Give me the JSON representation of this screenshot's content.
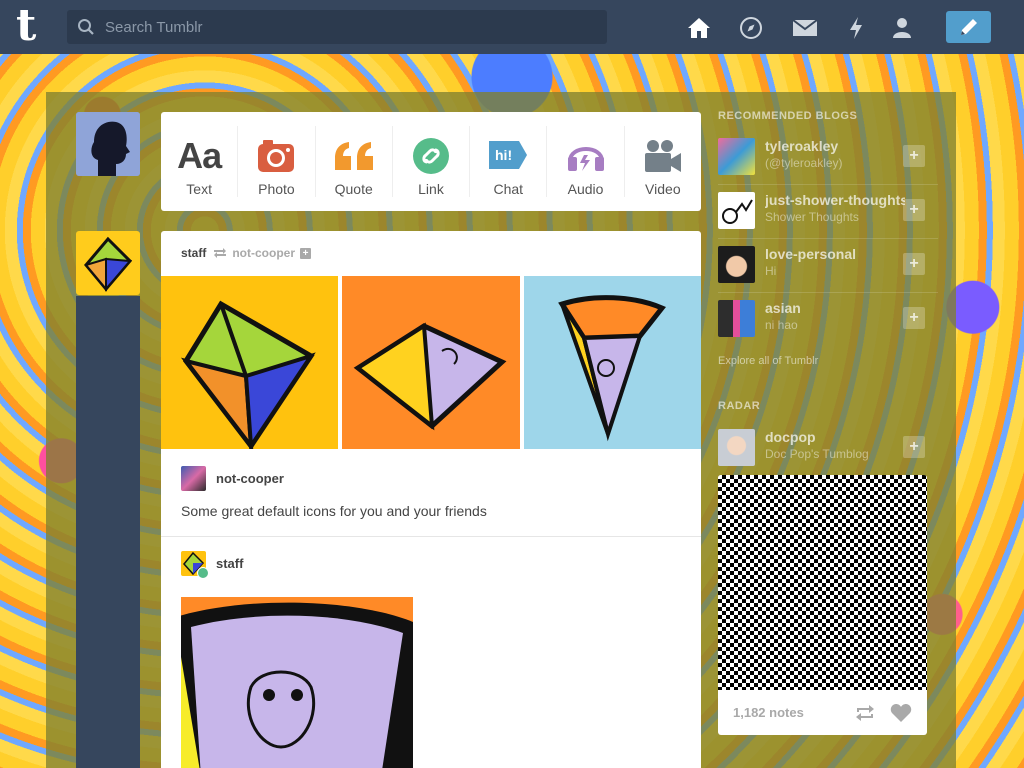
{
  "header": {
    "logo": "t",
    "search_placeholder": "Search Tumblr",
    "nav": [
      "home-icon",
      "explore-compass-icon",
      "inbox-icon",
      "activity-lightning-icon",
      "account-person-icon"
    ],
    "compose": "pencil-icon"
  },
  "composer": {
    "types": [
      {
        "label": "Text",
        "icon": "text-icon",
        "color": "#444444"
      },
      {
        "label": "Photo",
        "icon": "camera-icon",
        "color": "#d95e40"
      },
      {
        "label": "Quote",
        "icon": "quote-icon",
        "color": "#f2992e"
      },
      {
        "label": "Link",
        "icon": "link-icon",
        "color": "#56bc8a"
      },
      {
        "label": "Chat",
        "icon": "chat-icon",
        "color": "#529ecc"
      },
      {
        "label": "Audio",
        "icon": "headphones-icon",
        "color": "#a77dc2"
      },
      {
        "label": "Video",
        "icon": "video-camera-icon",
        "color": "#748089"
      }
    ]
  },
  "post": {
    "author": "staff",
    "reblogged_from": "not-cooper",
    "photoset_colors": [
      "#ffc20e",
      "#ff8a27",
      "#9ed6ea"
    ],
    "reblog_name": "not-cooper",
    "reblog_body": "Some great default icons for you and your friends",
    "staff_name": "staff"
  },
  "sidebar": {
    "recommended_title": "RECOMMENDED BLOGS",
    "blogs": [
      {
        "name": "tyleroakley",
        "sub": "(@tyleroakley)"
      },
      {
        "name": "just-shower-thoughts",
        "sub": "Shower Thoughts"
      },
      {
        "name": "love-personal",
        "sub": "Hi"
      },
      {
        "name": "asian",
        "sub": "ni hao"
      }
    ],
    "explore": "Explore all of Tumblr",
    "radar_title": "RADAR",
    "radar": {
      "name": "docpop",
      "sub": "Doc Pop's Tumblog",
      "notes": "1,182 notes"
    }
  }
}
